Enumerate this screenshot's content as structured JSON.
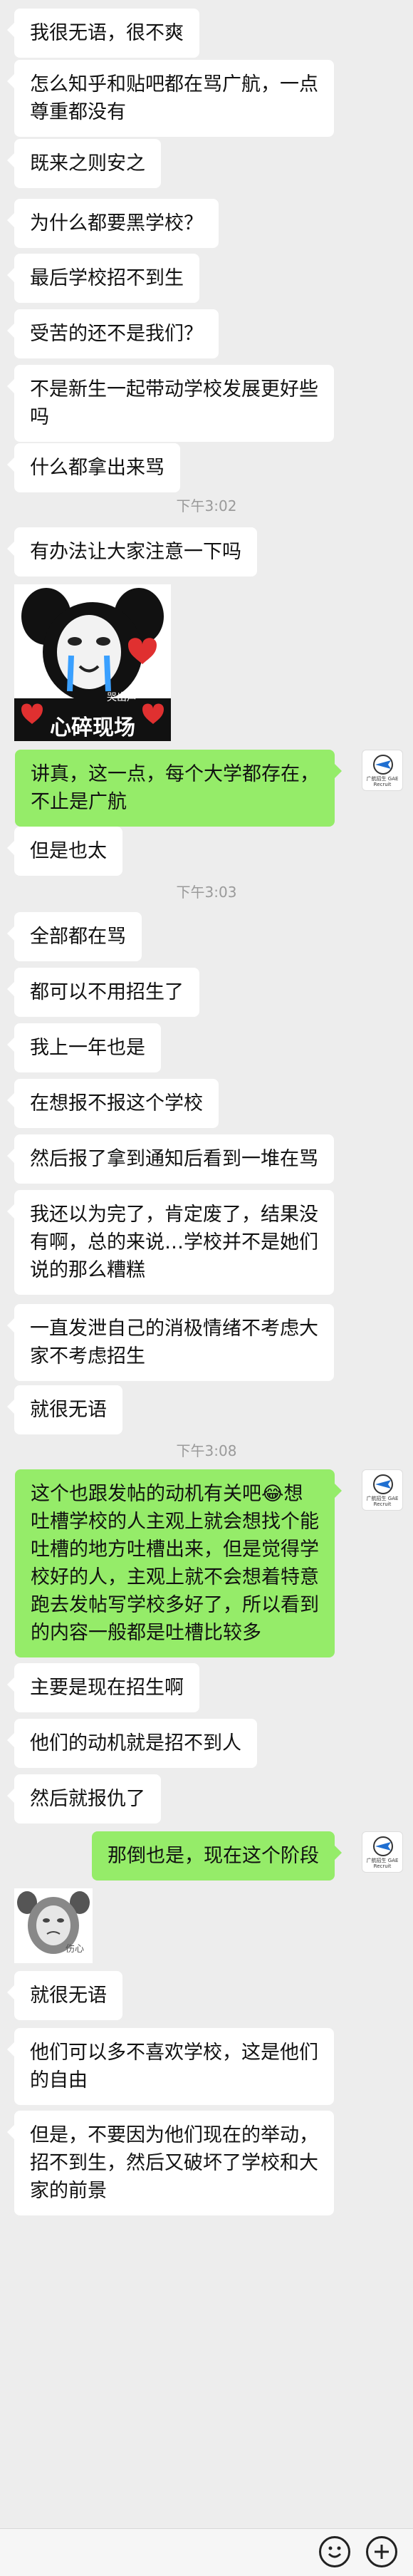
{
  "messages": [
    {
      "text": "我很无语，很不爽"
    },
    {
      "text": "怎么知乎和贴吧都在骂广航，一点\n尊重都没有"
    },
    {
      "text": "既来之则安之"
    },
    {
      "text": "为什么都要黑学校？"
    },
    {
      "text": "最后学校招不到生"
    },
    {
      "text": "受苦的还不是我们？"
    },
    {
      "text": "不是新生一起带动学校发展更好些\n吗"
    },
    {
      "text": "什么都拿出来骂"
    },
    {
      "text": "有办法让大家注意一下吗"
    },
    {
      "text": "讲真，这一点，每个大学都存在，\n不止是广航"
    },
    {
      "text": "但是也太"
    },
    {
      "text": "全部都在骂"
    },
    {
      "text": "都可以不用招生了"
    },
    {
      "text": "我上一年也是"
    },
    {
      "text": "在想报不报这个学校"
    },
    {
      "text": "然后报了拿到通知后看到一堆在骂"
    },
    {
      "text": "我还以为完了，肯定废了，结果没\n有啊，总的来说…学校并不是她们\n说的那么糟糕"
    },
    {
      "text": "一直发泄自己的消极情绪不考虑大\n家不考虑招生"
    },
    {
      "text": "就很无语"
    },
    {
      "text": "这个也跟发帖的动机有关吧😂想\n吐槽学校的人主观上就会想找个能\n吐槽的地方吐槽出来，但是觉得学\n校好的人，主观上就不会想着特意\n跑去发帖写学校多好了，所以看到\n的内容一般都是吐槽比较多"
    },
    {
      "text": "主要是现在招生啊"
    },
    {
      "text": "他们的动机就是招不到人"
    },
    {
      "text": "然后就报仇了"
    },
    {
      "text": "那倒也是，现在这个阶段"
    },
    {
      "text": "就很无语"
    },
    {
      "text": "他们可以多不喜欢学校，这是他们\n的自由"
    },
    {
      "text": "但是，不要因为他们现在的举动，\n招不到生，然后又破坏了学校和大\n家的前景"
    }
  ],
  "timestamps": [
    "下午3:02",
    "下午3:03",
    "下午3:08"
  ],
  "stickers": {
    "heartbreak_caption": "心碎现场",
    "heartbreak_small": "哭出声",
    "face_small": "伤心"
  },
  "my_avatar_caption": "广航招生 GAE Recruit",
  "colors": {
    "background": "#ededed",
    "incoming_bubble": "#ffffff",
    "outgoing_bubble": "#95ec69"
  },
  "icons": [
    "emoji-icon",
    "plus-icon",
    "heart-icon"
  ]
}
